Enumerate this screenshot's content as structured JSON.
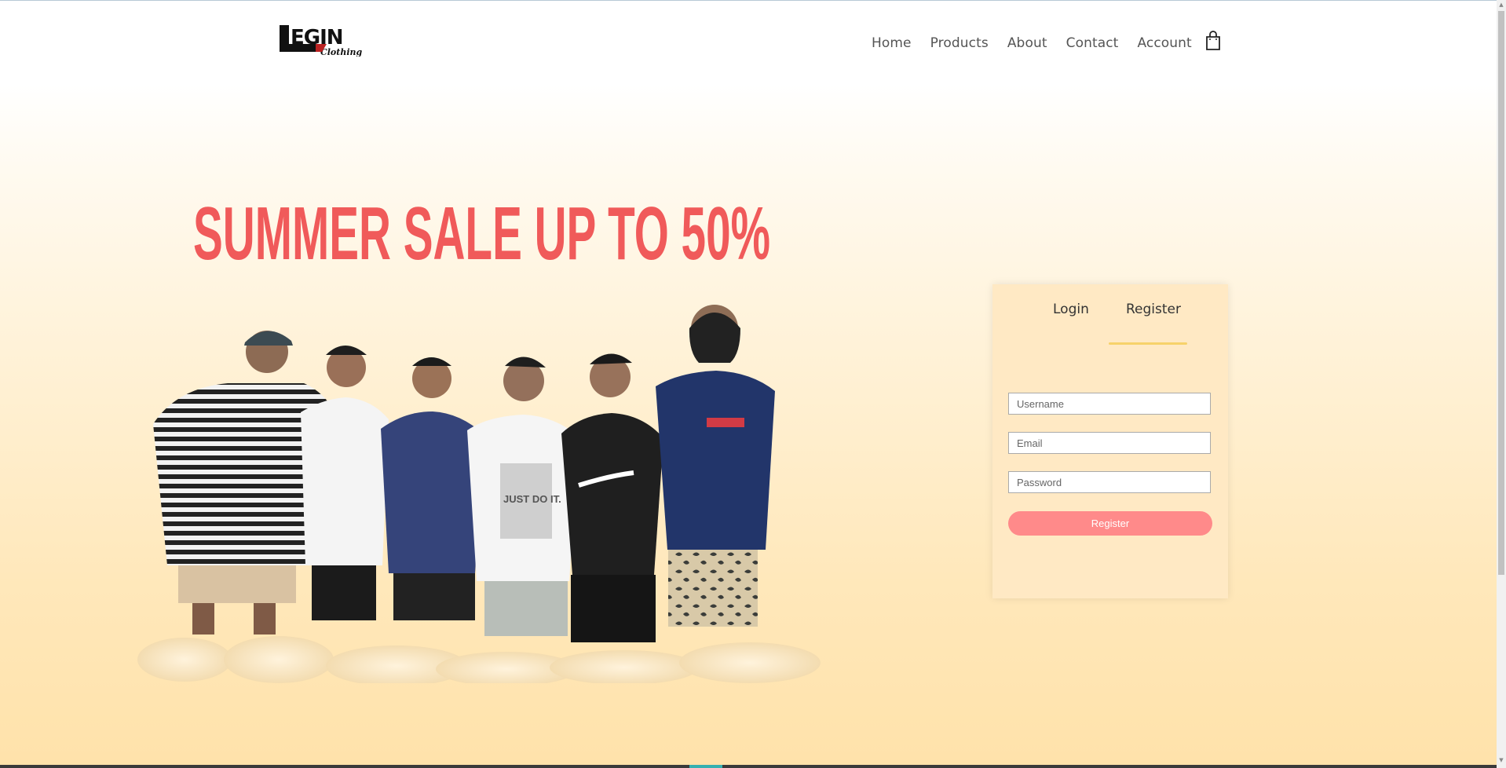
{
  "brand": {
    "logo_text": "LEGIN",
    "logo_subtext": "Clothing"
  },
  "nav": {
    "items": [
      {
        "label": "Home"
      },
      {
        "label": "Products"
      },
      {
        "label": "About"
      },
      {
        "label": "Contact"
      },
      {
        "label": "Account"
      }
    ]
  },
  "icons": {
    "cart": "shopping-bag-icon"
  },
  "hero": {
    "headline": "SUMMER SALE UP TO 50%",
    "headline_color": "#f05a5a",
    "shirt_print": "JUST DO IT."
  },
  "auth": {
    "tabs": [
      {
        "label": "Login"
      },
      {
        "label": "Register"
      }
    ],
    "active_tab": "Register",
    "fields": {
      "username_placeholder": "Username",
      "email_placeholder": "Email",
      "password_placeholder": "Password"
    },
    "submit_label": "Register",
    "accent_color": "#ff8a8a",
    "indicator_color": "#f7d26a"
  }
}
